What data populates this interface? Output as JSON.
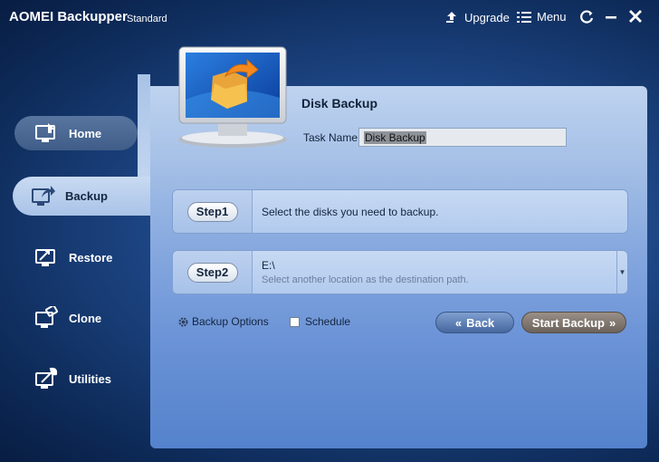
{
  "app": {
    "name": "AOMEI Backupper",
    "edition": "Standard"
  },
  "titlebar": {
    "upgrade_label": "Upgrade",
    "menu_label": "Menu"
  },
  "sidebar": {
    "items": [
      {
        "label": "Home",
        "icon": "home-icon"
      },
      {
        "label": "Backup",
        "icon": "backup-icon",
        "active": true
      },
      {
        "label": "Restore",
        "icon": "restore-icon"
      },
      {
        "label": "Clone",
        "icon": "clone-icon"
      },
      {
        "label": "Utilities",
        "icon": "utilities-icon"
      }
    ]
  },
  "main": {
    "title": "Disk Backup",
    "task_name_label": "Task Name",
    "task_name_value": "Disk Backup",
    "step1": {
      "label": "Step1",
      "text": "Select the disks you need to backup."
    },
    "step2": {
      "label": "Step2",
      "value": "E:\\",
      "hint": "Select another location as the destination path."
    },
    "backup_options_label": "Backup Options",
    "schedule_label": "Schedule",
    "back_label": "Back",
    "start_label": "Start Backup"
  },
  "colors": {
    "panel": "#a4bfe6",
    "background": "#1d4583",
    "back_button": "#5b7db4",
    "start_button": "#7d746c"
  }
}
